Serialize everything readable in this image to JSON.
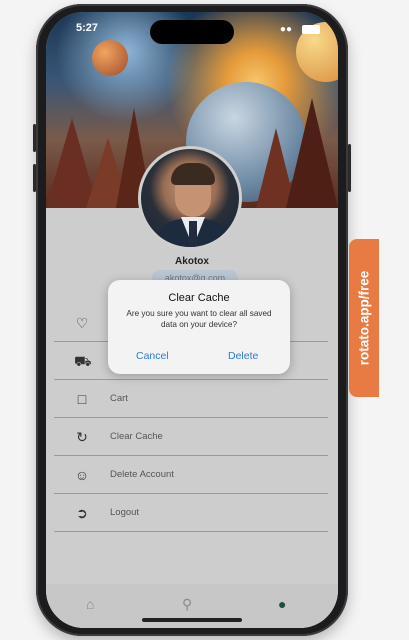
{
  "status": {
    "time": "5:27",
    "signal": "wifi"
  },
  "profile": {
    "name": "Akotox",
    "email": "akotox@g.com"
  },
  "menu": [
    {
      "icon": "heart-icon",
      "label": ""
    },
    {
      "icon": "truck-icon",
      "label": ""
    },
    {
      "icon": "bag-icon",
      "label": "Cart"
    },
    {
      "icon": "refresh-icon",
      "label": "Clear Cache"
    },
    {
      "icon": "user-remove-icon",
      "label": "Delete Account"
    },
    {
      "icon": "logout-icon",
      "label": "Logout"
    }
  ],
  "dialog": {
    "title": "Clear Cache",
    "message": "Are you sure you want to clear all saved data on your device?",
    "cancel": "Cancel",
    "delete": "Delete"
  },
  "nav": [
    {
      "icon": "home-icon",
      "active": false
    },
    {
      "icon": "search-icon",
      "active": false
    },
    {
      "icon": "person-icon",
      "active": true
    }
  ],
  "watermark": "rotato.app/free",
  "colors": {
    "accent": "#2f7cd6",
    "watermark": "#e87a43",
    "nav_active": "#1f4d3f"
  }
}
